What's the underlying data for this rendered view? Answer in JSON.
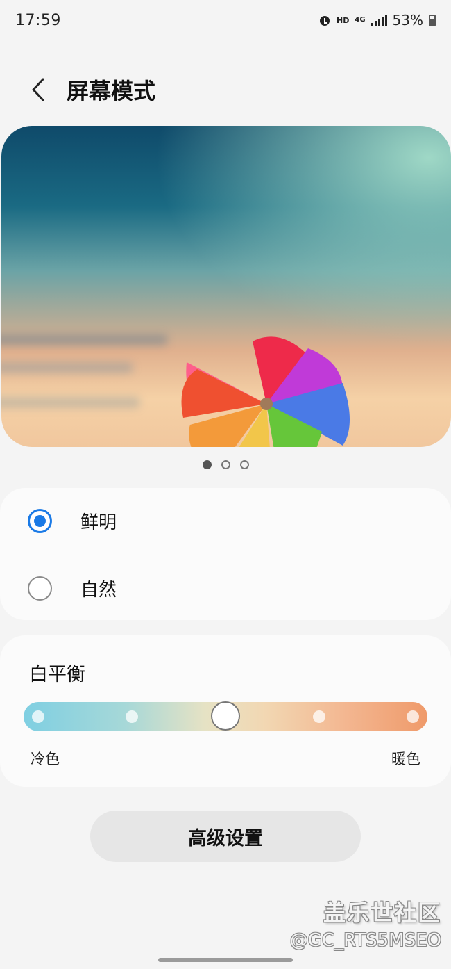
{
  "status_bar": {
    "time": "17:59",
    "hd": "HD",
    "network": "4G",
    "battery": "53%"
  },
  "header": {
    "title": "屏幕模式",
    "back_icon": "chevron-left-icon"
  },
  "preview": {
    "page_count": 3,
    "active_page": 1
  },
  "modes": {
    "items": [
      {
        "label": "鲜明",
        "selected": true
      },
      {
        "label": "自然",
        "selected": false
      }
    ]
  },
  "white_balance": {
    "title": "白平衡",
    "cool_label": "冷色",
    "warm_label": "暖色",
    "steps": 5,
    "current_step": 3
  },
  "advanced_button": {
    "label": "高级设置"
  },
  "watermark": {
    "logo": "盖乐世社区",
    "user": "@GC_RTS5MSEO"
  },
  "colors": {
    "accent": "#1a7ae6",
    "background": "#f4f4f4",
    "card": "#fbfbfb"
  }
}
